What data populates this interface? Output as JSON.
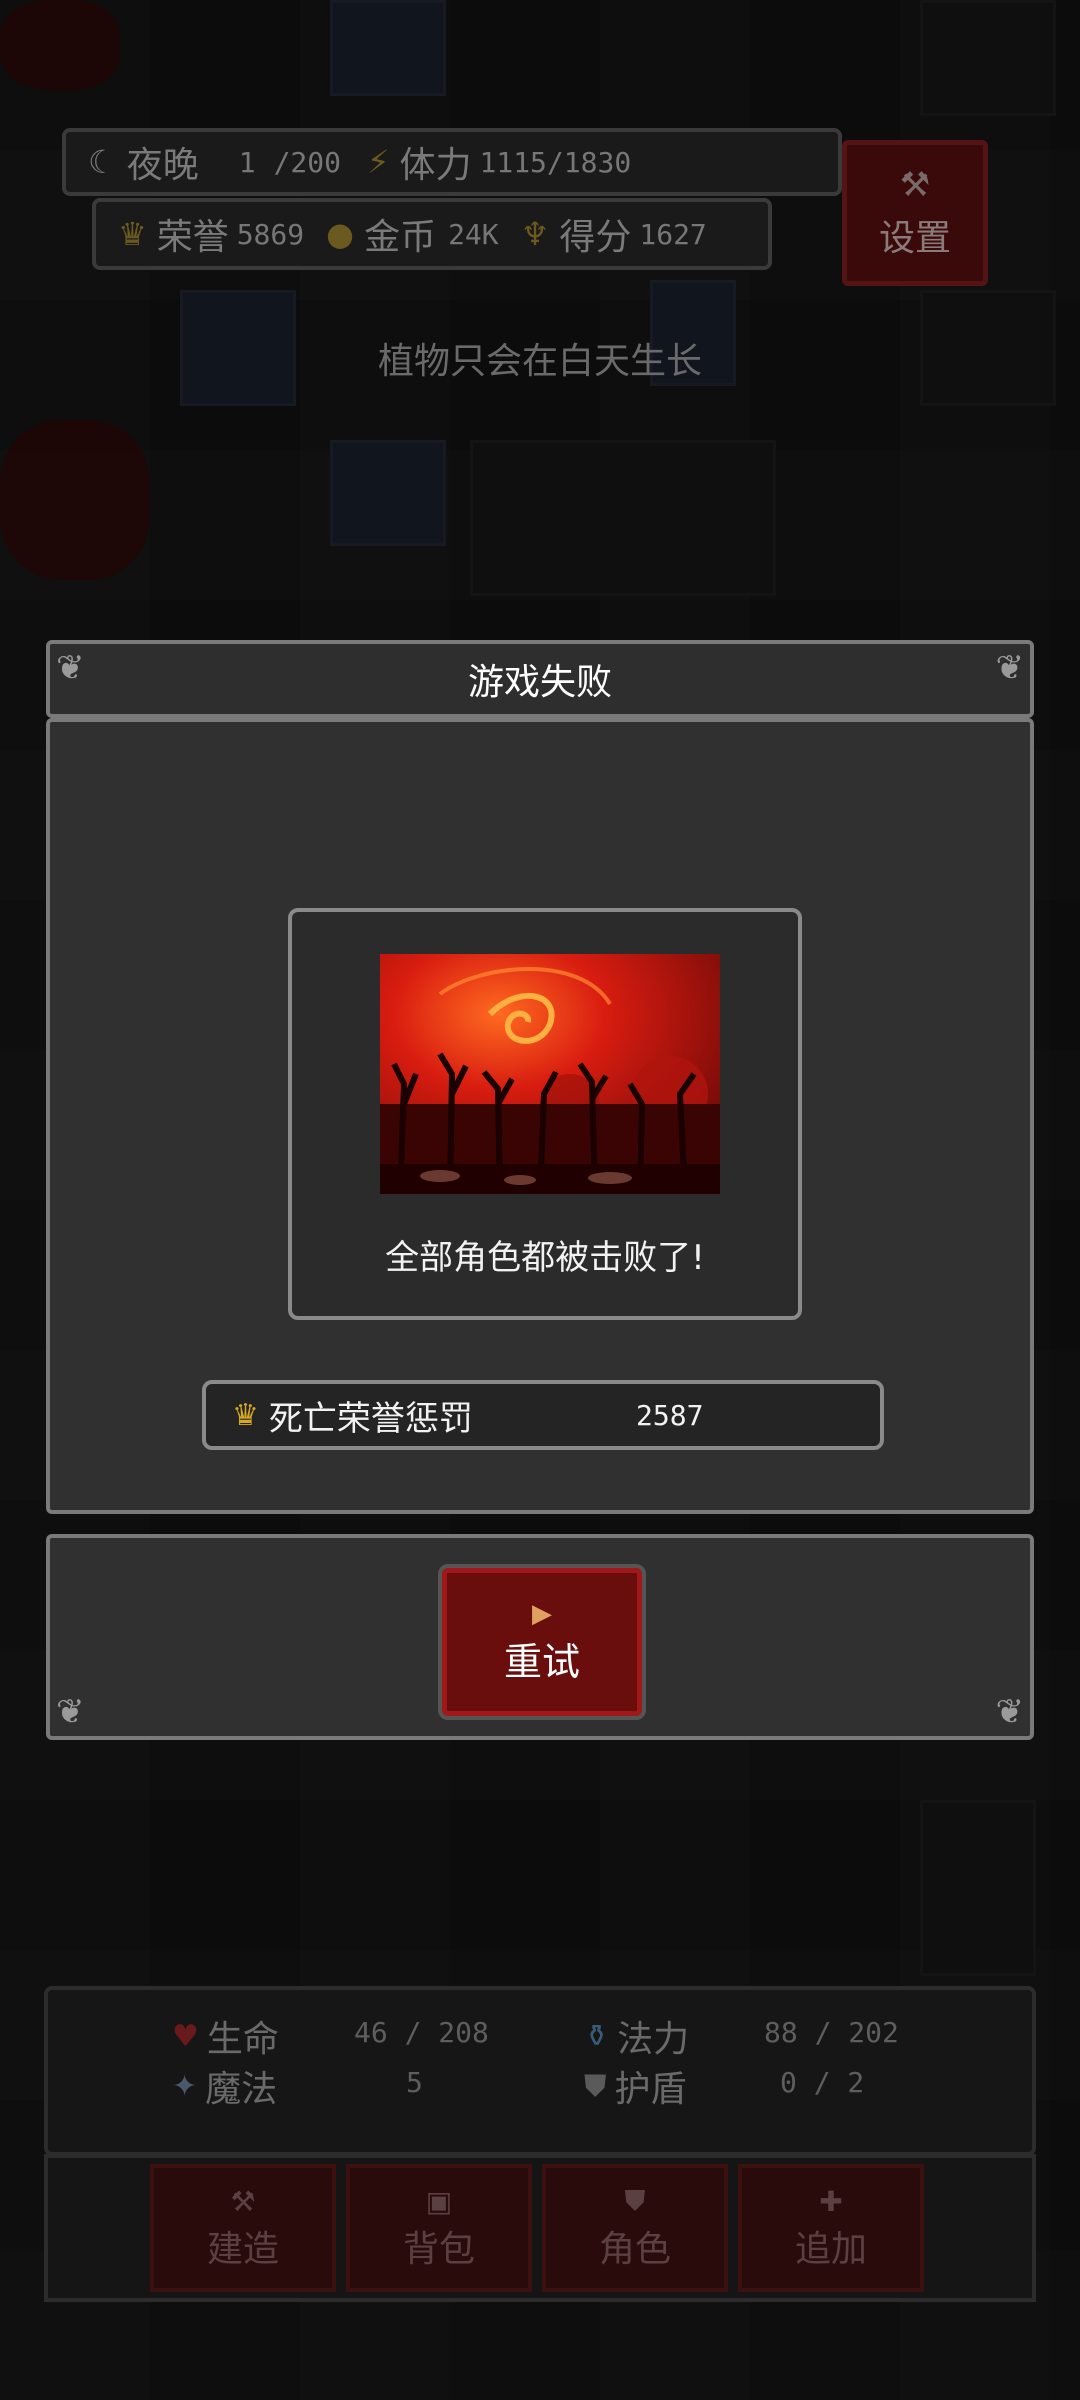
{
  "hud": {
    "night_label": "夜晚",
    "day_value": "1",
    "day_max": "/200",
    "stamina_label": "体力",
    "stamina_value": "1115/1830",
    "honor_label": "荣誉",
    "honor_value": "5869",
    "gold_label": "金币",
    "gold_value": "24K",
    "score_label": "得分",
    "score_value": "1627",
    "settings_label": "设置",
    "hint": "植物只会在白天生长"
  },
  "modal": {
    "title": "游戏失败",
    "message": "全部角色都被击败了!",
    "penalty_label": "死亡荣誉惩罚",
    "penalty_value": "2587",
    "retry_label": "重试"
  },
  "stats": {
    "life_label": "生命",
    "life_value": "46 / 208",
    "mana_label": "法力",
    "mana_value": "88 / 202",
    "magic_label": "魔法",
    "magic_value": "5",
    "shield_label": "护盾",
    "shield_value": "0 / 2"
  },
  "nav": {
    "build": "建造",
    "bag": "背包",
    "character": "角色",
    "add": "追加"
  },
  "colors": {
    "accent_red": "#a01818",
    "modal_border": "#7a7a7a",
    "crown_gold": "#d6a820"
  },
  "icons": [
    "moon-icon",
    "stamina-icon",
    "crown-icon",
    "coin-icon",
    "trophy-icon",
    "settings-icon",
    "play-icon",
    "heart-icon",
    "potion-icon",
    "magic-icon",
    "shield-icon",
    "hammer-icon",
    "bag-icon",
    "character-icon",
    "plus-icon"
  ]
}
